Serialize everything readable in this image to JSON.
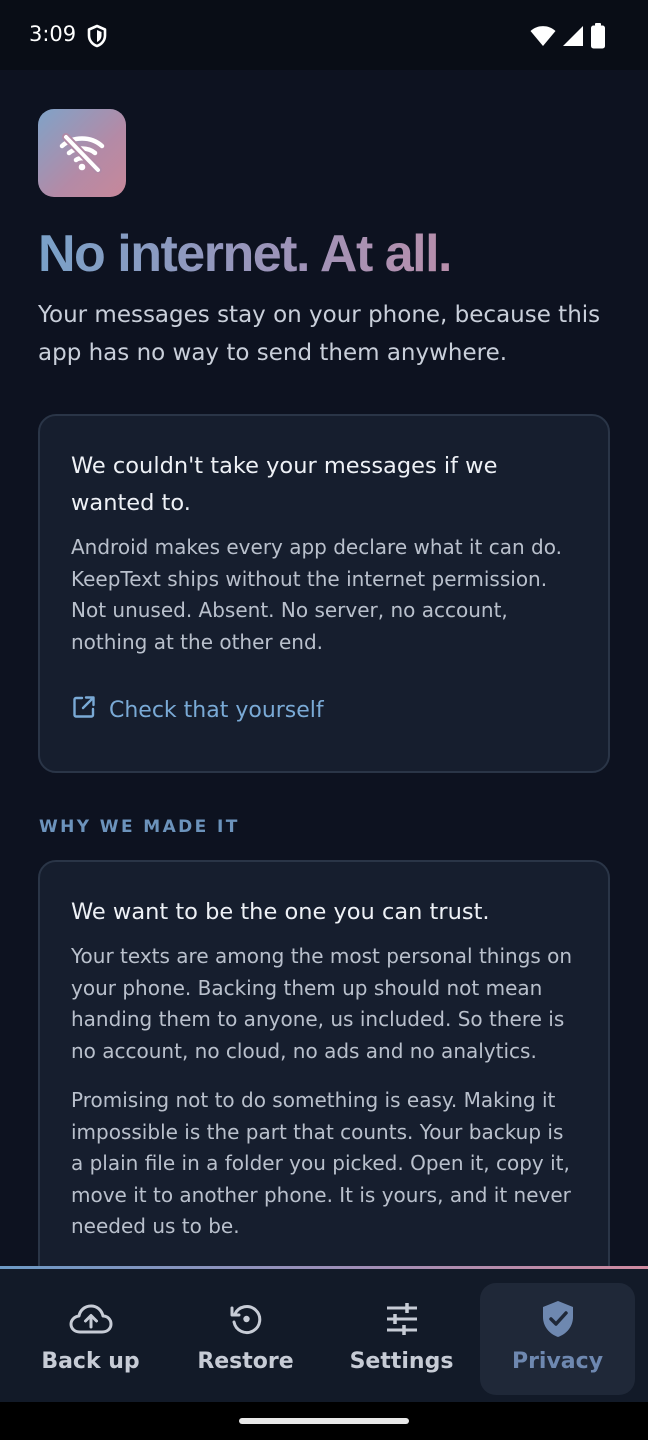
{
  "status_bar": {
    "time": "3:09",
    "icons": [
      "shield-icon",
      "wifi-icon",
      "cell-signal-icon",
      "battery-icon"
    ]
  },
  "hero": {
    "icon": "wifi-off-icon",
    "title": "No internet. At all.",
    "subtitle": "Your messages stay on your phone, because this app has no way to send them anywhere."
  },
  "card_permission": {
    "title": "We couldn't take your messages if we wanted to.",
    "body": "Android makes every app declare what it can do. KeepText ships without the internet permission. Not unused. Absent. No server, no account, nothing at the other end.",
    "link_icon": "open-in-new-icon",
    "link_label": "Check that yourself"
  },
  "section": {
    "label": "WHY WE MADE IT"
  },
  "card_trust": {
    "title": "We want to be the one you can trust.",
    "paragraph_1": "Your texts are among the most personal things on your phone. Backing them up should not mean handing them to anyone, us included. So there is no account, no cloud, no ads and no analytics.",
    "paragraph_2": "Promising not to do something is easy. Making it impossible is the part that counts. Your backup is a plain file in a folder you picked. Open it, copy it, move it to another phone. It is yours, and it never needed us to be."
  },
  "bottom_nav": {
    "items": [
      {
        "label": "Back up",
        "icon": "cloud-upload-icon",
        "active": false
      },
      {
        "label": "Restore",
        "icon": "history-icon",
        "active": false
      },
      {
        "label": "Settings",
        "icon": "tune-icon",
        "active": false
      },
      {
        "label": "Privacy",
        "icon": "shield-check-icon",
        "active": true
      }
    ]
  },
  "colors": {
    "background": "#0d1220",
    "card": "#161e2e",
    "accent_link": "#7aaad6",
    "gradient_start": "#7aa1c8",
    "gradient_end": "#d38a9d"
  }
}
